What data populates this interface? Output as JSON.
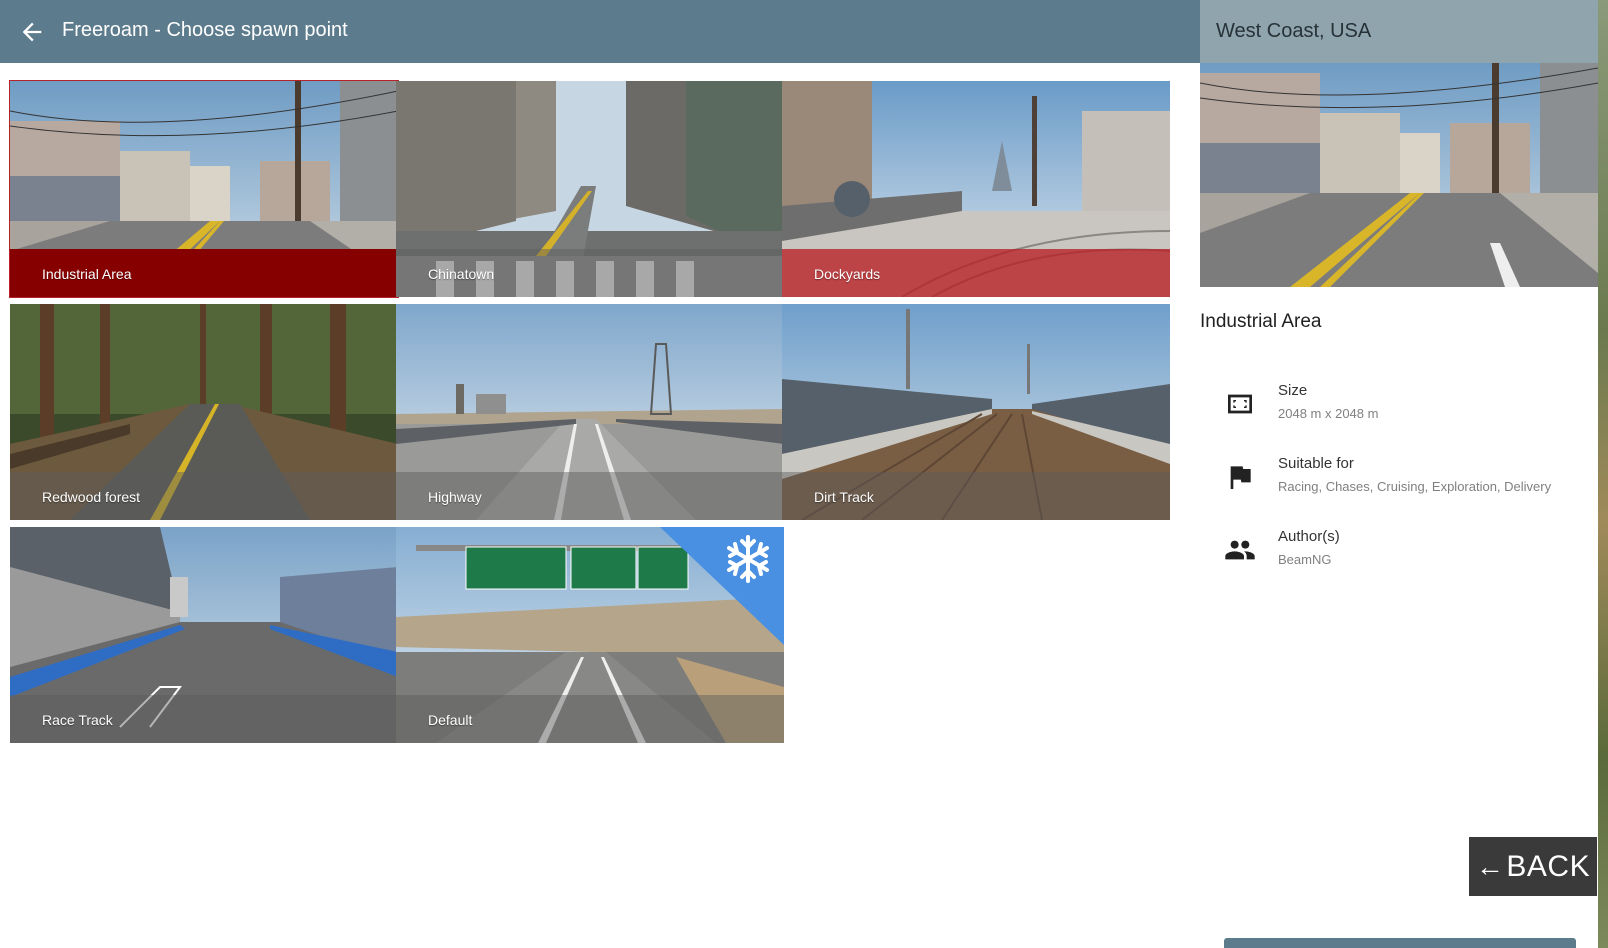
{
  "header": {
    "title": "Freeroam - Choose spawn point"
  },
  "spawn_points": [
    {
      "label": "Industrial Area",
      "selected": true
    },
    {
      "label": "Chinatown",
      "selected": false
    },
    {
      "label": "Dockyards",
      "selected": false,
      "hovered": true
    },
    {
      "label": "Redwood forest",
      "selected": false
    },
    {
      "label": "Highway",
      "selected": false
    },
    {
      "label": "Dirt Track",
      "selected": false
    },
    {
      "label": "Race Track",
      "selected": false
    },
    {
      "label": "Default",
      "selected": false,
      "badge": "snowflake-icon"
    }
  ],
  "details": {
    "region": "West Coast, USA",
    "selected_name": "Industrial Area",
    "size": {
      "title": "Size",
      "value": "2048 m x 2048 m",
      "icon": "size-frame-icon"
    },
    "suitable": {
      "title": "Suitable for",
      "value": "Racing, Chases, Cruising, Exploration, Delivery",
      "icon": "flag-icon"
    },
    "authors": {
      "title": "Author(s)",
      "value": "BeamNG",
      "icon": "people-icon"
    }
  },
  "back_button": {
    "label": "BACK"
  },
  "colors": {
    "topbar": "#5c7b8c",
    "panel_header": "#90a4ae",
    "selected_caption": "#870000",
    "hover_caption": "#b81e24",
    "snow_badge": "#4a90e2"
  }
}
